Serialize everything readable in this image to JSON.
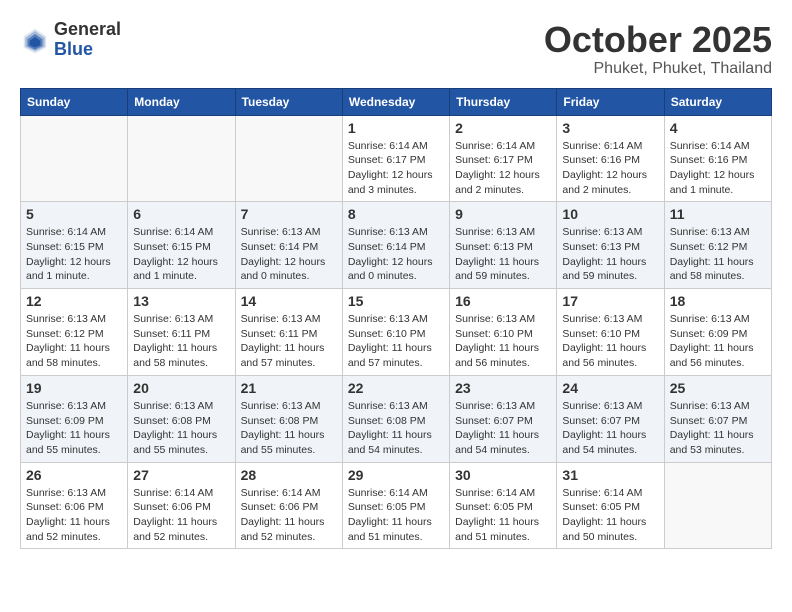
{
  "header": {
    "logo": {
      "line1": "General",
      "line2": "Blue"
    },
    "month": "October 2025",
    "location": "Phuket, Phuket, Thailand"
  },
  "weekdays": [
    "Sunday",
    "Monday",
    "Tuesday",
    "Wednesday",
    "Thursday",
    "Friday",
    "Saturday"
  ],
  "weeks": [
    [
      {
        "day": "",
        "info": ""
      },
      {
        "day": "",
        "info": ""
      },
      {
        "day": "",
        "info": ""
      },
      {
        "day": "1",
        "info": "Sunrise: 6:14 AM\nSunset: 6:17 PM\nDaylight: 12 hours and 3 minutes."
      },
      {
        "day": "2",
        "info": "Sunrise: 6:14 AM\nSunset: 6:17 PM\nDaylight: 12 hours and 2 minutes."
      },
      {
        "day": "3",
        "info": "Sunrise: 6:14 AM\nSunset: 6:16 PM\nDaylight: 12 hours and 2 minutes."
      },
      {
        "day": "4",
        "info": "Sunrise: 6:14 AM\nSunset: 6:16 PM\nDaylight: 12 hours and 1 minute."
      }
    ],
    [
      {
        "day": "5",
        "info": "Sunrise: 6:14 AM\nSunset: 6:15 PM\nDaylight: 12 hours and 1 minute."
      },
      {
        "day": "6",
        "info": "Sunrise: 6:14 AM\nSunset: 6:15 PM\nDaylight: 12 hours and 1 minute."
      },
      {
        "day": "7",
        "info": "Sunrise: 6:13 AM\nSunset: 6:14 PM\nDaylight: 12 hours and 0 minutes."
      },
      {
        "day": "8",
        "info": "Sunrise: 6:13 AM\nSunset: 6:14 PM\nDaylight: 12 hours and 0 minutes."
      },
      {
        "day": "9",
        "info": "Sunrise: 6:13 AM\nSunset: 6:13 PM\nDaylight: 11 hours and 59 minutes."
      },
      {
        "day": "10",
        "info": "Sunrise: 6:13 AM\nSunset: 6:13 PM\nDaylight: 11 hours and 59 minutes."
      },
      {
        "day": "11",
        "info": "Sunrise: 6:13 AM\nSunset: 6:12 PM\nDaylight: 11 hours and 58 minutes."
      }
    ],
    [
      {
        "day": "12",
        "info": "Sunrise: 6:13 AM\nSunset: 6:12 PM\nDaylight: 11 hours and 58 minutes."
      },
      {
        "day": "13",
        "info": "Sunrise: 6:13 AM\nSunset: 6:11 PM\nDaylight: 11 hours and 58 minutes."
      },
      {
        "day": "14",
        "info": "Sunrise: 6:13 AM\nSunset: 6:11 PM\nDaylight: 11 hours and 57 minutes."
      },
      {
        "day": "15",
        "info": "Sunrise: 6:13 AM\nSunset: 6:10 PM\nDaylight: 11 hours and 57 minutes."
      },
      {
        "day": "16",
        "info": "Sunrise: 6:13 AM\nSunset: 6:10 PM\nDaylight: 11 hours and 56 minutes."
      },
      {
        "day": "17",
        "info": "Sunrise: 6:13 AM\nSunset: 6:10 PM\nDaylight: 11 hours and 56 minutes."
      },
      {
        "day": "18",
        "info": "Sunrise: 6:13 AM\nSunset: 6:09 PM\nDaylight: 11 hours and 56 minutes."
      }
    ],
    [
      {
        "day": "19",
        "info": "Sunrise: 6:13 AM\nSunset: 6:09 PM\nDaylight: 11 hours and 55 minutes."
      },
      {
        "day": "20",
        "info": "Sunrise: 6:13 AM\nSunset: 6:08 PM\nDaylight: 11 hours and 55 minutes."
      },
      {
        "day": "21",
        "info": "Sunrise: 6:13 AM\nSunset: 6:08 PM\nDaylight: 11 hours and 55 minutes."
      },
      {
        "day": "22",
        "info": "Sunrise: 6:13 AM\nSunset: 6:08 PM\nDaylight: 11 hours and 54 minutes."
      },
      {
        "day": "23",
        "info": "Sunrise: 6:13 AM\nSunset: 6:07 PM\nDaylight: 11 hours and 54 minutes."
      },
      {
        "day": "24",
        "info": "Sunrise: 6:13 AM\nSunset: 6:07 PM\nDaylight: 11 hours and 54 minutes."
      },
      {
        "day": "25",
        "info": "Sunrise: 6:13 AM\nSunset: 6:07 PM\nDaylight: 11 hours and 53 minutes."
      }
    ],
    [
      {
        "day": "26",
        "info": "Sunrise: 6:13 AM\nSunset: 6:06 PM\nDaylight: 11 hours and 52 minutes."
      },
      {
        "day": "27",
        "info": "Sunrise: 6:14 AM\nSunset: 6:06 PM\nDaylight: 11 hours and 52 minutes."
      },
      {
        "day": "28",
        "info": "Sunrise: 6:14 AM\nSunset: 6:06 PM\nDaylight: 11 hours and 52 minutes."
      },
      {
        "day": "29",
        "info": "Sunrise: 6:14 AM\nSunset: 6:05 PM\nDaylight: 11 hours and 51 minutes."
      },
      {
        "day": "30",
        "info": "Sunrise: 6:14 AM\nSunset: 6:05 PM\nDaylight: 11 hours and 51 minutes."
      },
      {
        "day": "31",
        "info": "Sunrise: 6:14 AM\nSunset: 6:05 PM\nDaylight: 11 hours and 50 minutes."
      },
      {
        "day": "",
        "info": ""
      }
    ]
  ]
}
